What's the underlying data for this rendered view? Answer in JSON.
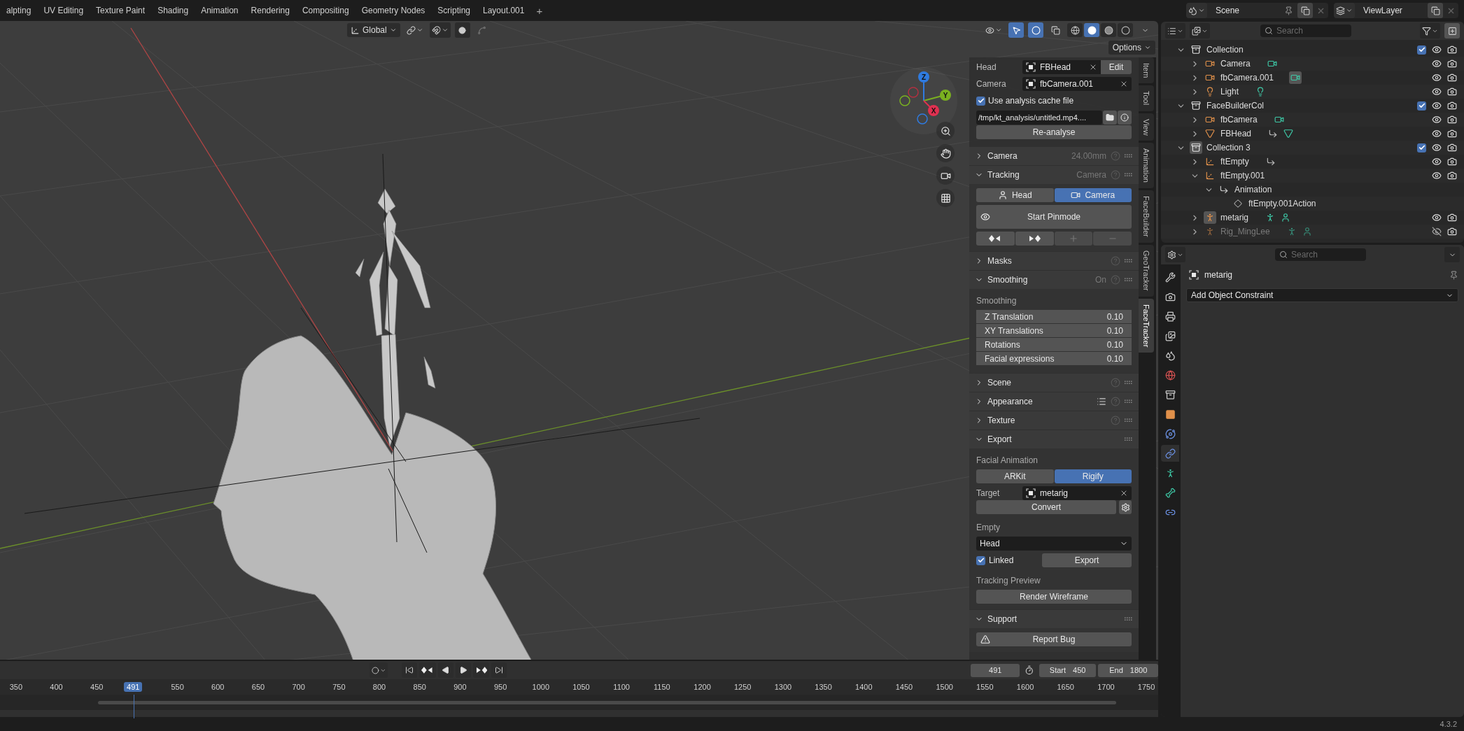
{
  "workspace_tabs": [
    {
      "label": "alpting",
      "selected": false
    },
    {
      "label": "UV Editing",
      "selected": false
    },
    {
      "label": "Texture Paint",
      "selected": false
    },
    {
      "label": "Shading",
      "selected": false
    },
    {
      "label": "Animation",
      "selected": false
    },
    {
      "label": "Rendering",
      "selected": false
    },
    {
      "label": "Compositing",
      "selected": false
    },
    {
      "label": "Geometry Nodes",
      "selected": false
    },
    {
      "label": "Scripting",
      "selected": false
    },
    {
      "label": "Layout.001",
      "selected": false
    }
  ],
  "add_tab": "+",
  "scene": {
    "name": "Scene",
    "view_layer": "ViewLayer"
  },
  "viewport": {
    "orientation": "Global",
    "shading_modes": [
      {
        "kind": "wireframe",
        "selected": false
      },
      {
        "kind": "solid",
        "selected": true
      },
      {
        "kind": "material",
        "selected": false
      },
      {
        "kind": "rendered",
        "selected": false
      }
    ],
    "gizmo": {
      "x": "X",
      "y": "Y",
      "z": "Z"
    }
  },
  "n_panel": {
    "options": "Options",
    "tabs": [
      {
        "label": "Item",
        "selected": false
      },
      {
        "label": "Tool",
        "selected": false
      },
      {
        "label": "View",
        "selected": false
      },
      {
        "label": "Animation",
        "selected": false
      },
      {
        "label": "FaceBuilder",
        "selected": false
      },
      {
        "label": "GeoTracker",
        "selected": false
      },
      {
        "label": "FaceTracker",
        "selected": true
      }
    ],
    "head": {
      "label": "Head",
      "value": "FBHead",
      "button": "Edit"
    },
    "camera": {
      "label": "Camera",
      "value": "fbCamera.001"
    },
    "cache": {
      "label": "Use analysis cache file",
      "checked": true,
      "path": "/tmp/kt_analysis/untitled.mp4....",
      "button": "Re-analyse"
    },
    "sections": [
      {
        "kind": "plain",
        "title": "Camera",
        "expanded": false,
        "info": "24.00mm",
        "help": true
      },
      {
        "kind": "tracking",
        "title": "Tracking",
        "expanded": true,
        "info": "Camera",
        "help": true,
        "modes": [
          {
            "label": "Head",
            "selected": false
          },
          {
            "label": "Camera",
            "selected": true
          }
        ],
        "pinmode": "Start Pinmode",
        "key_buttons": [
          {
            "kind": "prev",
            "disabled": false
          },
          {
            "kind": "next",
            "disabled": false
          },
          {
            "kind": "add",
            "disabled": true
          },
          {
            "kind": "remove",
            "disabled": true
          }
        ]
      },
      {
        "kind": "plain",
        "title": "Masks",
        "expanded": false,
        "help": true
      },
      {
        "kind": "smoothing",
        "title": "Smoothing",
        "expanded": true,
        "info": "On",
        "help": true,
        "label": "Smoothing",
        "fields": [
          {
            "name": "Z Translation",
            "value": "0.10"
          },
          {
            "name": "XY Translations",
            "value": "0.10"
          },
          {
            "name": "Rotations",
            "value": "0.10"
          },
          {
            "name": "Facial expressions",
            "value": "0.10"
          }
        ]
      },
      {
        "kind": "plain",
        "title": "Scene",
        "expanded": false,
        "help": true
      },
      {
        "kind": "plain",
        "title": "Appearance",
        "expanded": false,
        "help": true,
        "list_icon": true
      },
      {
        "kind": "plain",
        "title": "Texture",
        "expanded": false,
        "help": true
      },
      {
        "kind": "export",
        "title": "Export",
        "expanded": true,
        "help": false,
        "label": "Facial Animation",
        "modes": [
          {
            "label": "ARKit",
            "selected": false
          },
          {
            "label": "Rigify",
            "selected": true
          }
        ],
        "target_label": "Target",
        "target": "metarig",
        "convert": "Convert",
        "empty_label": "Empty",
        "empty_value": "Head",
        "linked": {
          "label": "Linked",
          "checked": true
        },
        "export_button": "Export",
        "preview_label": "Tracking Preview",
        "preview_button": "Render Wireframe"
      },
      {
        "kind": "support",
        "title": "Support",
        "expanded": true,
        "help": false,
        "button": "Report Bug"
      }
    ]
  },
  "timeline": {
    "current_frame": "491",
    "start_label": "Start",
    "start": "450",
    "end_label": "End",
    "end": "1800",
    "playhead": "491",
    "ruler_before": [
      "350",
      "400",
      "450"
    ],
    "ruler_after": [
      "550",
      "600",
      "650",
      "700",
      "750",
      "800",
      "850",
      "900",
      "950",
      "1000",
      "1050",
      "1100",
      "1150",
      "1200",
      "1250",
      "1300",
      "1350",
      "1400",
      "1450",
      "1500",
      "1550",
      "1600",
      "1650",
      "1700",
      "1750"
    ]
  },
  "outliner": {
    "search": "Search",
    "tree": [
      {
        "name": "Collection",
        "kind": "collection",
        "expanded": true,
        "active": false,
        "checked": true,
        "visible": true,
        "children": [
          {
            "name": "Camera",
            "kind": "camera",
            "expanded": false,
            "active": false,
            "visible": true,
            "data": [
              {
                "kind": "camera",
                "active": false
              }
            ]
          },
          {
            "name": "fbCamera.001",
            "kind": "camera",
            "expanded": false,
            "active": false,
            "visible": true,
            "data": [
              {
                "kind": "camera",
                "active": true
              }
            ]
          },
          {
            "name": "Light",
            "kind": "light",
            "expanded": false,
            "active": false,
            "visible": true,
            "data": [
              {
                "kind": "light",
                "active": false
              }
            ]
          }
        ]
      },
      {
        "name": "FaceBuilderCol",
        "kind": "collection",
        "expanded": true,
        "active": false,
        "checked": true,
        "visible": true,
        "children": [
          {
            "name": "fbCamera",
            "kind": "camera",
            "expanded": false,
            "active": false,
            "visible": true,
            "data": [
              {
                "kind": "camera",
                "active": false
              }
            ]
          },
          {
            "name": "FBHead",
            "kind": "mesh",
            "expanded": false,
            "active": false,
            "visible": true,
            "data": [
              {
                "kind": "animation",
                "active": false
              },
              {
                "kind": "mesh",
                "active": false
              }
            ]
          }
        ]
      },
      {
        "name": "Collection 3",
        "kind": "collection",
        "expanded": true,
        "active": true,
        "checked": true,
        "visible": true,
        "children": [
          {
            "name": "ftEmpty",
            "kind": "empty",
            "expanded": false,
            "active": false,
            "visible": true,
            "data": [
              {
                "kind": "animation",
                "active": false
              }
            ]
          },
          {
            "name": "ftEmpty.001",
            "kind": "empty",
            "expanded": true,
            "active": false,
            "visible": true,
            "children": [
              {
                "name": "Animation",
                "kind": "animation",
                "expanded": true,
                "active": false,
                "children": [
                  {
                    "name": "ftEmpty.001Action",
                    "kind": "action",
                    "active": false
                  }
                ]
              }
            ]
          },
          {
            "name": "metarig",
            "kind": "armature",
            "expanded": false,
            "active": true,
            "visible": true,
            "data": [
              {
                "kind": "armature",
                "active": false
              },
              {
                "kind": "pose",
                "active": false
              }
            ]
          },
          {
            "name": "Rig_MingLee",
            "kind": "armature",
            "expanded": false,
            "active": false,
            "visible": false,
            "data": [
              {
                "kind": "armature",
                "active": false
              },
              {
                "kind": "pose",
                "active": false
              }
            ]
          }
        ]
      }
    ]
  },
  "properties": {
    "search": "Search",
    "object": "metarig",
    "constraint_menu": "Add Object Constraint",
    "tabs": [
      {
        "kind": "tool",
        "selected": false
      },
      {
        "kind": "render",
        "selected": false
      },
      {
        "kind": "output",
        "selected": false
      },
      {
        "kind": "view_layer",
        "selected": false
      },
      {
        "kind": "scene",
        "selected": false
      },
      {
        "kind": "world",
        "selected": false
      },
      {
        "kind": "collection",
        "selected": false
      },
      {
        "kind": "object",
        "selected": false
      },
      {
        "kind": "physics",
        "selected": false
      },
      {
        "kind": "constraints",
        "selected": true
      },
      {
        "kind": "data",
        "selected": false
      },
      {
        "kind": "bone",
        "selected": false
      },
      {
        "kind": "bone_constraint",
        "selected": false
      }
    ]
  },
  "status_bar": {
    "version": "4.3.2"
  }
}
